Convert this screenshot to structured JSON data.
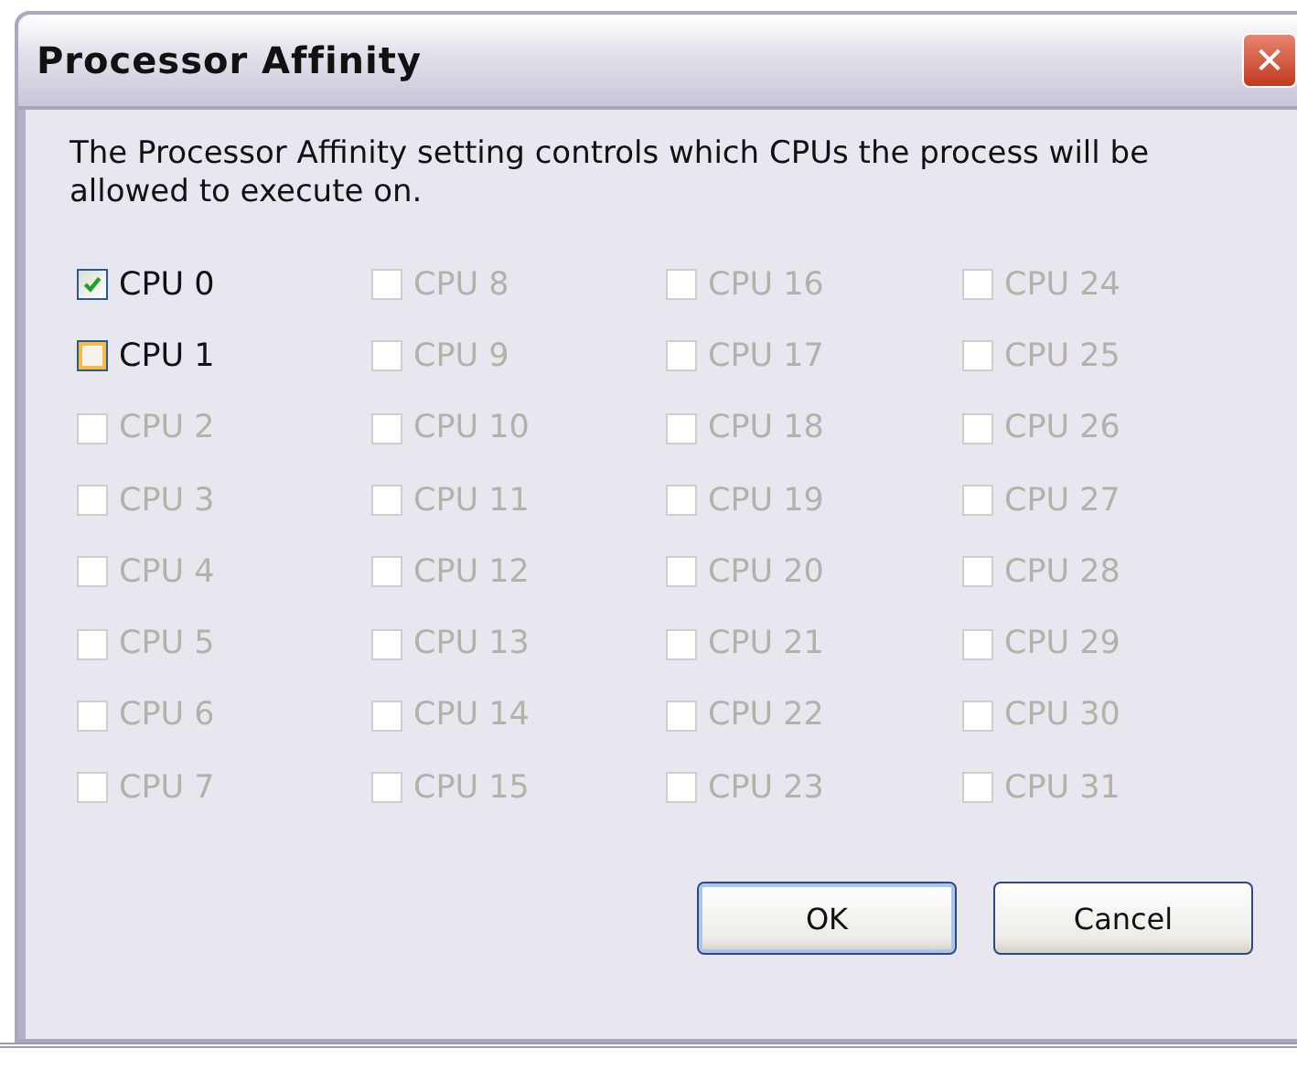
{
  "window": {
    "title": "Processor Affinity",
    "close": "✕"
  },
  "description": "The Processor Affinity setting controls which CPUs the process will be allowed to execute on.",
  "cpus": [
    {
      "label": "CPU 0",
      "checked": true,
      "disabled": false,
      "hovered": false
    },
    {
      "label": "CPU 1",
      "checked": false,
      "disabled": false,
      "hovered": true
    },
    {
      "label": "CPU 2",
      "checked": false,
      "disabled": true,
      "hovered": false
    },
    {
      "label": "CPU 3",
      "checked": false,
      "disabled": true,
      "hovered": false
    },
    {
      "label": "CPU 4",
      "checked": false,
      "disabled": true,
      "hovered": false
    },
    {
      "label": "CPU 5",
      "checked": false,
      "disabled": true,
      "hovered": false
    },
    {
      "label": "CPU 6",
      "checked": false,
      "disabled": true,
      "hovered": false
    },
    {
      "label": "CPU 7",
      "checked": false,
      "disabled": true,
      "hovered": false
    },
    {
      "label": "CPU 8",
      "checked": false,
      "disabled": true,
      "hovered": false
    },
    {
      "label": "CPU 9",
      "checked": false,
      "disabled": true,
      "hovered": false
    },
    {
      "label": "CPU 10",
      "checked": false,
      "disabled": true,
      "hovered": false
    },
    {
      "label": "CPU 11",
      "checked": false,
      "disabled": true,
      "hovered": false
    },
    {
      "label": "CPU 12",
      "checked": false,
      "disabled": true,
      "hovered": false
    },
    {
      "label": "CPU 13",
      "checked": false,
      "disabled": true,
      "hovered": false
    },
    {
      "label": "CPU 14",
      "checked": false,
      "disabled": true,
      "hovered": false
    },
    {
      "label": "CPU 15",
      "checked": false,
      "disabled": true,
      "hovered": false
    },
    {
      "label": "CPU 16",
      "checked": false,
      "disabled": true,
      "hovered": false
    },
    {
      "label": "CPU 17",
      "checked": false,
      "disabled": true,
      "hovered": false
    },
    {
      "label": "CPU 18",
      "checked": false,
      "disabled": true,
      "hovered": false
    },
    {
      "label": "CPU 19",
      "checked": false,
      "disabled": true,
      "hovered": false
    },
    {
      "label": "CPU 20",
      "checked": false,
      "disabled": true,
      "hovered": false
    },
    {
      "label": "CPU 21",
      "checked": false,
      "disabled": true,
      "hovered": false
    },
    {
      "label": "CPU 22",
      "checked": false,
      "disabled": true,
      "hovered": false
    },
    {
      "label": "CPU 23",
      "checked": false,
      "disabled": true,
      "hovered": false
    },
    {
      "label": "CPU 24",
      "checked": false,
      "disabled": true,
      "hovered": false
    },
    {
      "label": "CPU 25",
      "checked": false,
      "disabled": true,
      "hovered": false
    },
    {
      "label": "CPU 26",
      "checked": false,
      "disabled": true,
      "hovered": false
    },
    {
      "label": "CPU 27",
      "checked": false,
      "disabled": true,
      "hovered": false
    },
    {
      "label": "CPU 28",
      "checked": false,
      "disabled": true,
      "hovered": false
    },
    {
      "label": "CPU 29",
      "checked": false,
      "disabled": true,
      "hovered": false
    },
    {
      "label": "CPU 30",
      "checked": false,
      "disabled": true,
      "hovered": false
    },
    {
      "label": "CPU 31",
      "checked": false,
      "disabled": true,
      "hovered": false
    }
  ],
  "buttons": [
    {
      "label": "OK",
      "default": true
    },
    {
      "label": "Cancel",
      "default": false
    }
  ]
}
